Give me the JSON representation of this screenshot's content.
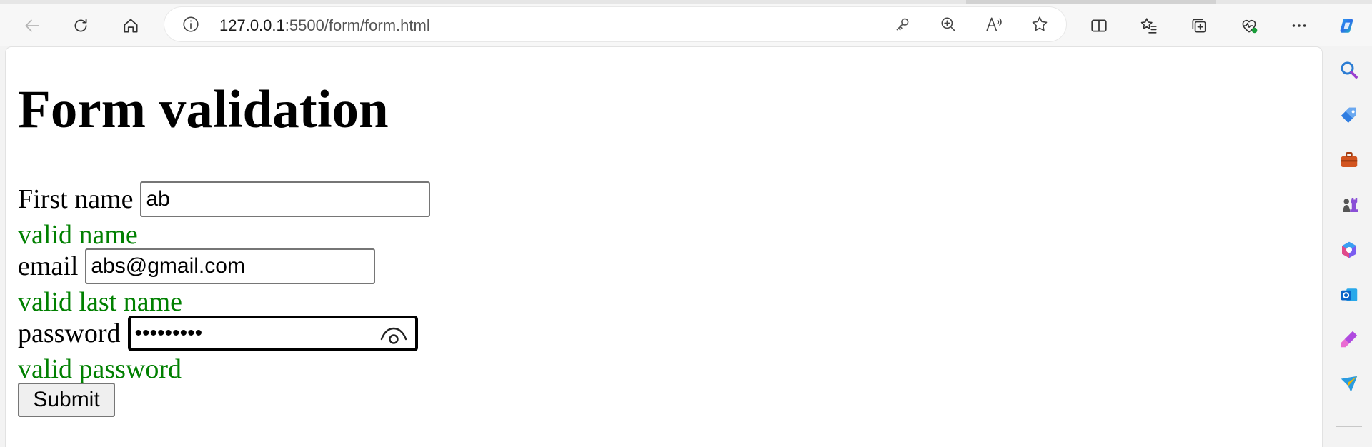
{
  "browser": {
    "url_host": "127.0.0.1",
    "url_path": ":5500/form/form.html",
    "toolbar_icons": [
      "back-icon",
      "refresh-icon",
      "home-icon"
    ],
    "address_icons": [
      "info-icon",
      "key-icon",
      "zoom-icon",
      "read-aloud-icon",
      "favorite-star-icon"
    ],
    "right_icons": [
      "split-screen-icon",
      "favorites-icon",
      "collections-icon",
      "browser-essentials-icon",
      "more-icon",
      "copilot-icon"
    ],
    "sidebar_icons": [
      "search-icon",
      "shopping-tag-icon",
      "tools-icon",
      "games-icon",
      "microsoft-365-icon",
      "outlook-icon",
      "designer-icon",
      "send-icon"
    ]
  },
  "page": {
    "title": "Form validation",
    "first_name": {
      "label": "First name",
      "value": "ab",
      "message": "valid name"
    },
    "email": {
      "label": "email",
      "value": "abs@gmail.com",
      "message": "valid last name"
    },
    "password": {
      "label": "password",
      "value": "•••••••••",
      "message": "valid password"
    },
    "submit_label": "Submit",
    "valid_color": "#008000"
  }
}
